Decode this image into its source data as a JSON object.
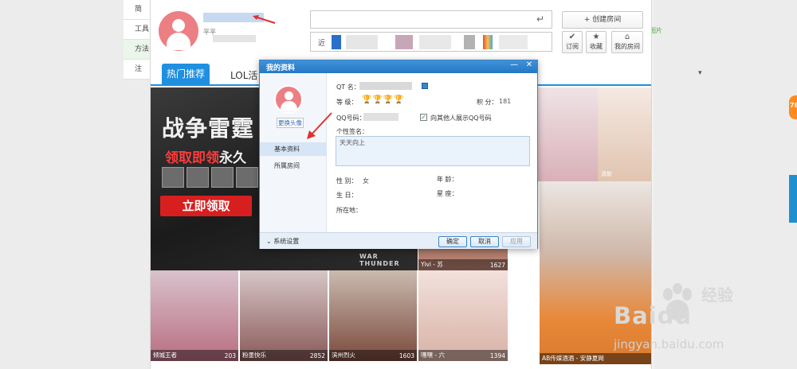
{
  "left_nav": {
    "items": [
      {
        "label": "简"
      },
      {
        "label": "工具"
      },
      {
        "label": "方法",
        "active": true
      },
      {
        "label": "注"
      }
    ]
  },
  "header": {
    "user_level_text": "平平",
    "search_value": "",
    "recent_label": "近",
    "dropdown_icon": "▾",
    "create_room_label": "+ 创建房间",
    "actions": [
      {
        "label": "订阅",
        "icon": "check-icon",
        "glyph": "✔"
      },
      {
        "label": "收藏",
        "icon": "star-icon",
        "glyph": "★"
      },
      {
        "label": "我的房间",
        "icon": "home-icon",
        "glyph": "⌂"
      }
    ]
  },
  "tabs": [
    {
      "label": "热门推荐",
      "active": true
    },
    {
      "label": "LOL活"
    }
  ],
  "banner": {
    "title": "战争雷霆",
    "subtitle_red": "领取即领",
    "subtitle_white": "永久",
    "cta": "立即领取",
    "footer_text": "WAR THUNDER"
  },
  "thumbs": [
    {
      "name": "",
      "count": "",
      "color": "#2a2a2a"
    },
    {
      "name": "Yivi - 苏",
      "count": "1627",
      "color": "#c58a78"
    },
    {
      "name": "",
      "count": "",
      "color": "#d9b0b8"
    },
    {
      "name": "清新",
      "count": "",
      "color": "#e1c4b0"
    },
    {
      "name": "",
      "count": "",
      "color": "#cfb7a8"
    },
    {
      "name": "倾城王者",
      "count": "203",
      "color": "#b86e82"
    },
    {
      "name": "粉墨快乐",
      "count": "2852",
      "color": "#8a5a5a"
    },
    {
      "name": "滨州烈火",
      "count": "1603",
      "color": "#7a4a3c"
    },
    {
      "name": "嘿嘿 - 六",
      "count": "1394",
      "color": "#d8b1a6"
    },
    {
      "name": "AB传媒酒酒 - 安静夏网",
      "count": "",
      "color": "#e8893a"
    }
  ],
  "dialog": {
    "title": "我的资料",
    "min_glyph": "—",
    "close_glyph": "✕",
    "change_avatar": "更换头像",
    "side_items": [
      {
        "label": "基本资料",
        "active": true
      },
      {
        "label": "所属房间"
      }
    ],
    "fields": {
      "qt_label": "QT 名：",
      "level_label": "等  级：",
      "level_glyphs": "🏆🏆🏆🏆",
      "score_label": "积  分：",
      "score_value": "181",
      "qq_label": "QQ号码：",
      "show_qq_label": "向其他人展示QQ号码",
      "show_qq_checked": true,
      "signature_label": "个性签名：",
      "signature_value": "天天向上",
      "gender_label": "性  别：",
      "gender_value": "女",
      "age_label": "年  龄：",
      "birthday_label": "生  日：",
      "constellation_label": "星  座：",
      "location_label": "所在地："
    },
    "footer": {
      "settings_label": "系统设置",
      "ok_label": "确定",
      "cancel_label": "取消",
      "apply_label": "应用"
    }
  },
  "right": {
    "img_label": "图片",
    "badge_label": "78"
  },
  "watermark": {
    "text_latin": "Baidu",
    "text_cn": "经验",
    "url": "jingyan.baidu.com"
  }
}
